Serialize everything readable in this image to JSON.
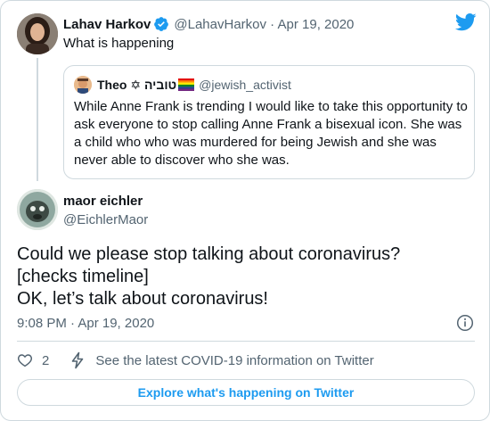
{
  "parent_tweet": {
    "author_name": "Lahav Harkov",
    "handle_date": "@LahavHarkov · Apr 19, 2020",
    "text": "What is happening"
  },
  "quoted_tweet": {
    "author_name": "Theo ✡ טוביה",
    "handle": "@jewish_activist",
    "text": "While Anne Frank is trending I would like to take this opportunity to ask everyone to stop calling Anne Frank a bisexual icon. She was a child who who was murdered for being Jewish and she was never able to discover who she was."
  },
  "main_tweet": {
    "author_name": "maor eichler",
    "handle": "@EichlerMaor",
    "lines": [
      "Could we please stop talking about coronavirus?",
      "[checks timeline]",
      "OK, let’s talk about coronavirus!"
    ],
    "timestamp": "9:08 PM · Apr 19, 2020"
  },
  "actions": {
    "like_count": "2",
    "covid_info": "See the latest COVID-19 information on Twitter"
  },
  "explore_button": "Explore what's happening on Twitter",
  "icons": {
    "logo": "twitter-bird-icon",
    "verified": "verified-badge-icon",
    "info": "info-icon",
    "like": "heart-icon",
    "covid": "lightning-icon"
  },
  "colors": {
    "accent": "#1d9bf0",
    "text_primary": "#0f1419",
    "text_secondary": "#536471",
    "border": "#cfd9de"
  }
}
